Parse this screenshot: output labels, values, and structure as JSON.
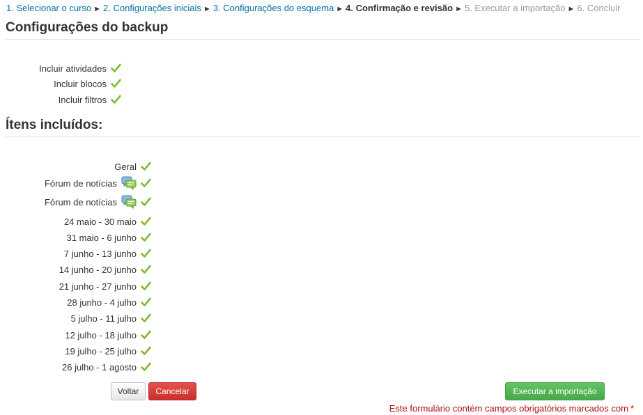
{
  "breadcrumb": {
    "steps": [
      "1. Selecionar o curso",
      "2. Configurações iniciais",
      "3. Configurações do esquema",
      "4. Confirmação e revisão",
      "5. Executar a importação",
      "6. Concluir"
    ],
    "separator": "►"
  },
  "backup_settings": {
    "title": "Configurações do backup",
    "items": [
      "Incluir atividades",
      "Incluir blocos",
      "Incluir filtros"
    ]
  },
  "included_items": {
    "title": "Ítens incluídos:",
    "items": [
      "Geral",
      "Fórum de notícias",
      "Fórum de notícias",
      "24 maio - 30 maio",
      "31 maio - 6 junho",
      "7 junho - 13 junho",
      "14 junho - 20 junho",
      "21 junho - 27 junho",
      "28 junho - 4 julho",
      "5 julho - 11 julho",
      "12 julho - 18 julho",
      "19 julho - 25 julho",
      "26 julho - 1 agosto"
    ]
  },
  "buttons": {
    "back": "Voltar",
    "cancel": "Cancelar",
    "execute": "Executar a importação"
  },
  "required_note": {
    "text": "Este formulário contém campos obrigatórios marcados com",
    "star": "*"
  },
  "colors": {
    "link": "#0070a8",
    "check": "#7ab51d",
    "cancel": "#d9403a",
    "execute": "#5bb75b",
    "required": "#aa1111"
  },
  "icons": {
    "check": "check-icon",
    "forum": "forum-icon"
  }
}
